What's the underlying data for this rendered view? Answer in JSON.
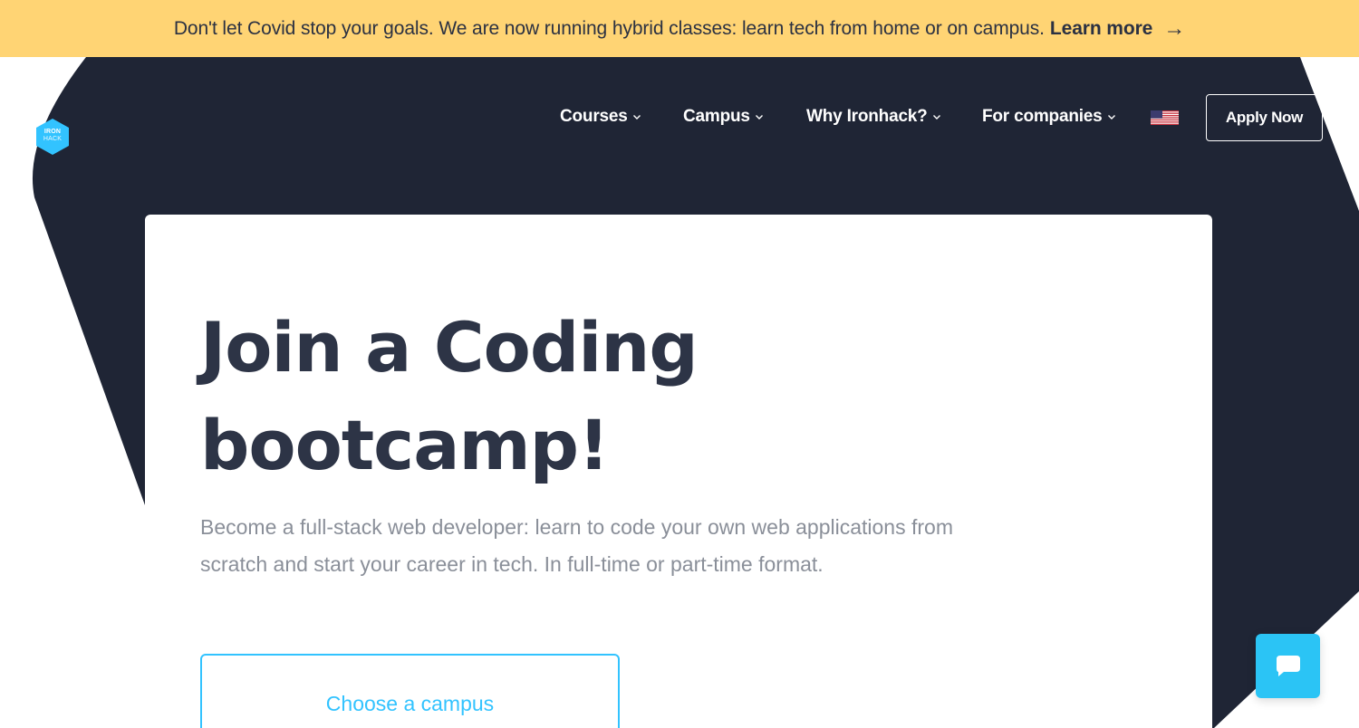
{
  "banner": {
    "message": "Don't let Covid stop your goals. We are now running hybrid classes: learn tech from home or on campus.",
    "link_label": "Learn more",
    "link_arrow": "→",
    "background_color": "#ffd474"
  },
  "logo": {
    "line1": "IRON",
    "line2": "HACK",
    "color": "#32c3ff"
  },
  "nav": {
    "items": [
      {
        "label": "Courses",
        "icon": "chevron-down-icon"
      },
      {
        "label": "Campus",
        "icon": "chevron-down-icon"
      },
      {
        "label": "Why Ironhack?",
        "icon": "chevron-down-icon"
      },
      {
        "label": "For companies",
        "icon": "chevron-down-icon"
      }
    ],
    "language_icon": "us-flag-icon",
    "apply_label": "Apply Now",
    "background_color": "#1f2535"
  },
  "hero": {
    "title": "Join a Coding bootcamp!",
    "description": "Become a full-stack web developer: learn to code your own web applications from scratch and start your career in tech. In full-time or part-time format.",
    "campus_button_label": "Choose a campus",
    "accent_color": "#32c3ff"
  },
  "chat": {
    "icon": "chat-bubble-icon",
    "color": "#2bc4f5"
  }
}
